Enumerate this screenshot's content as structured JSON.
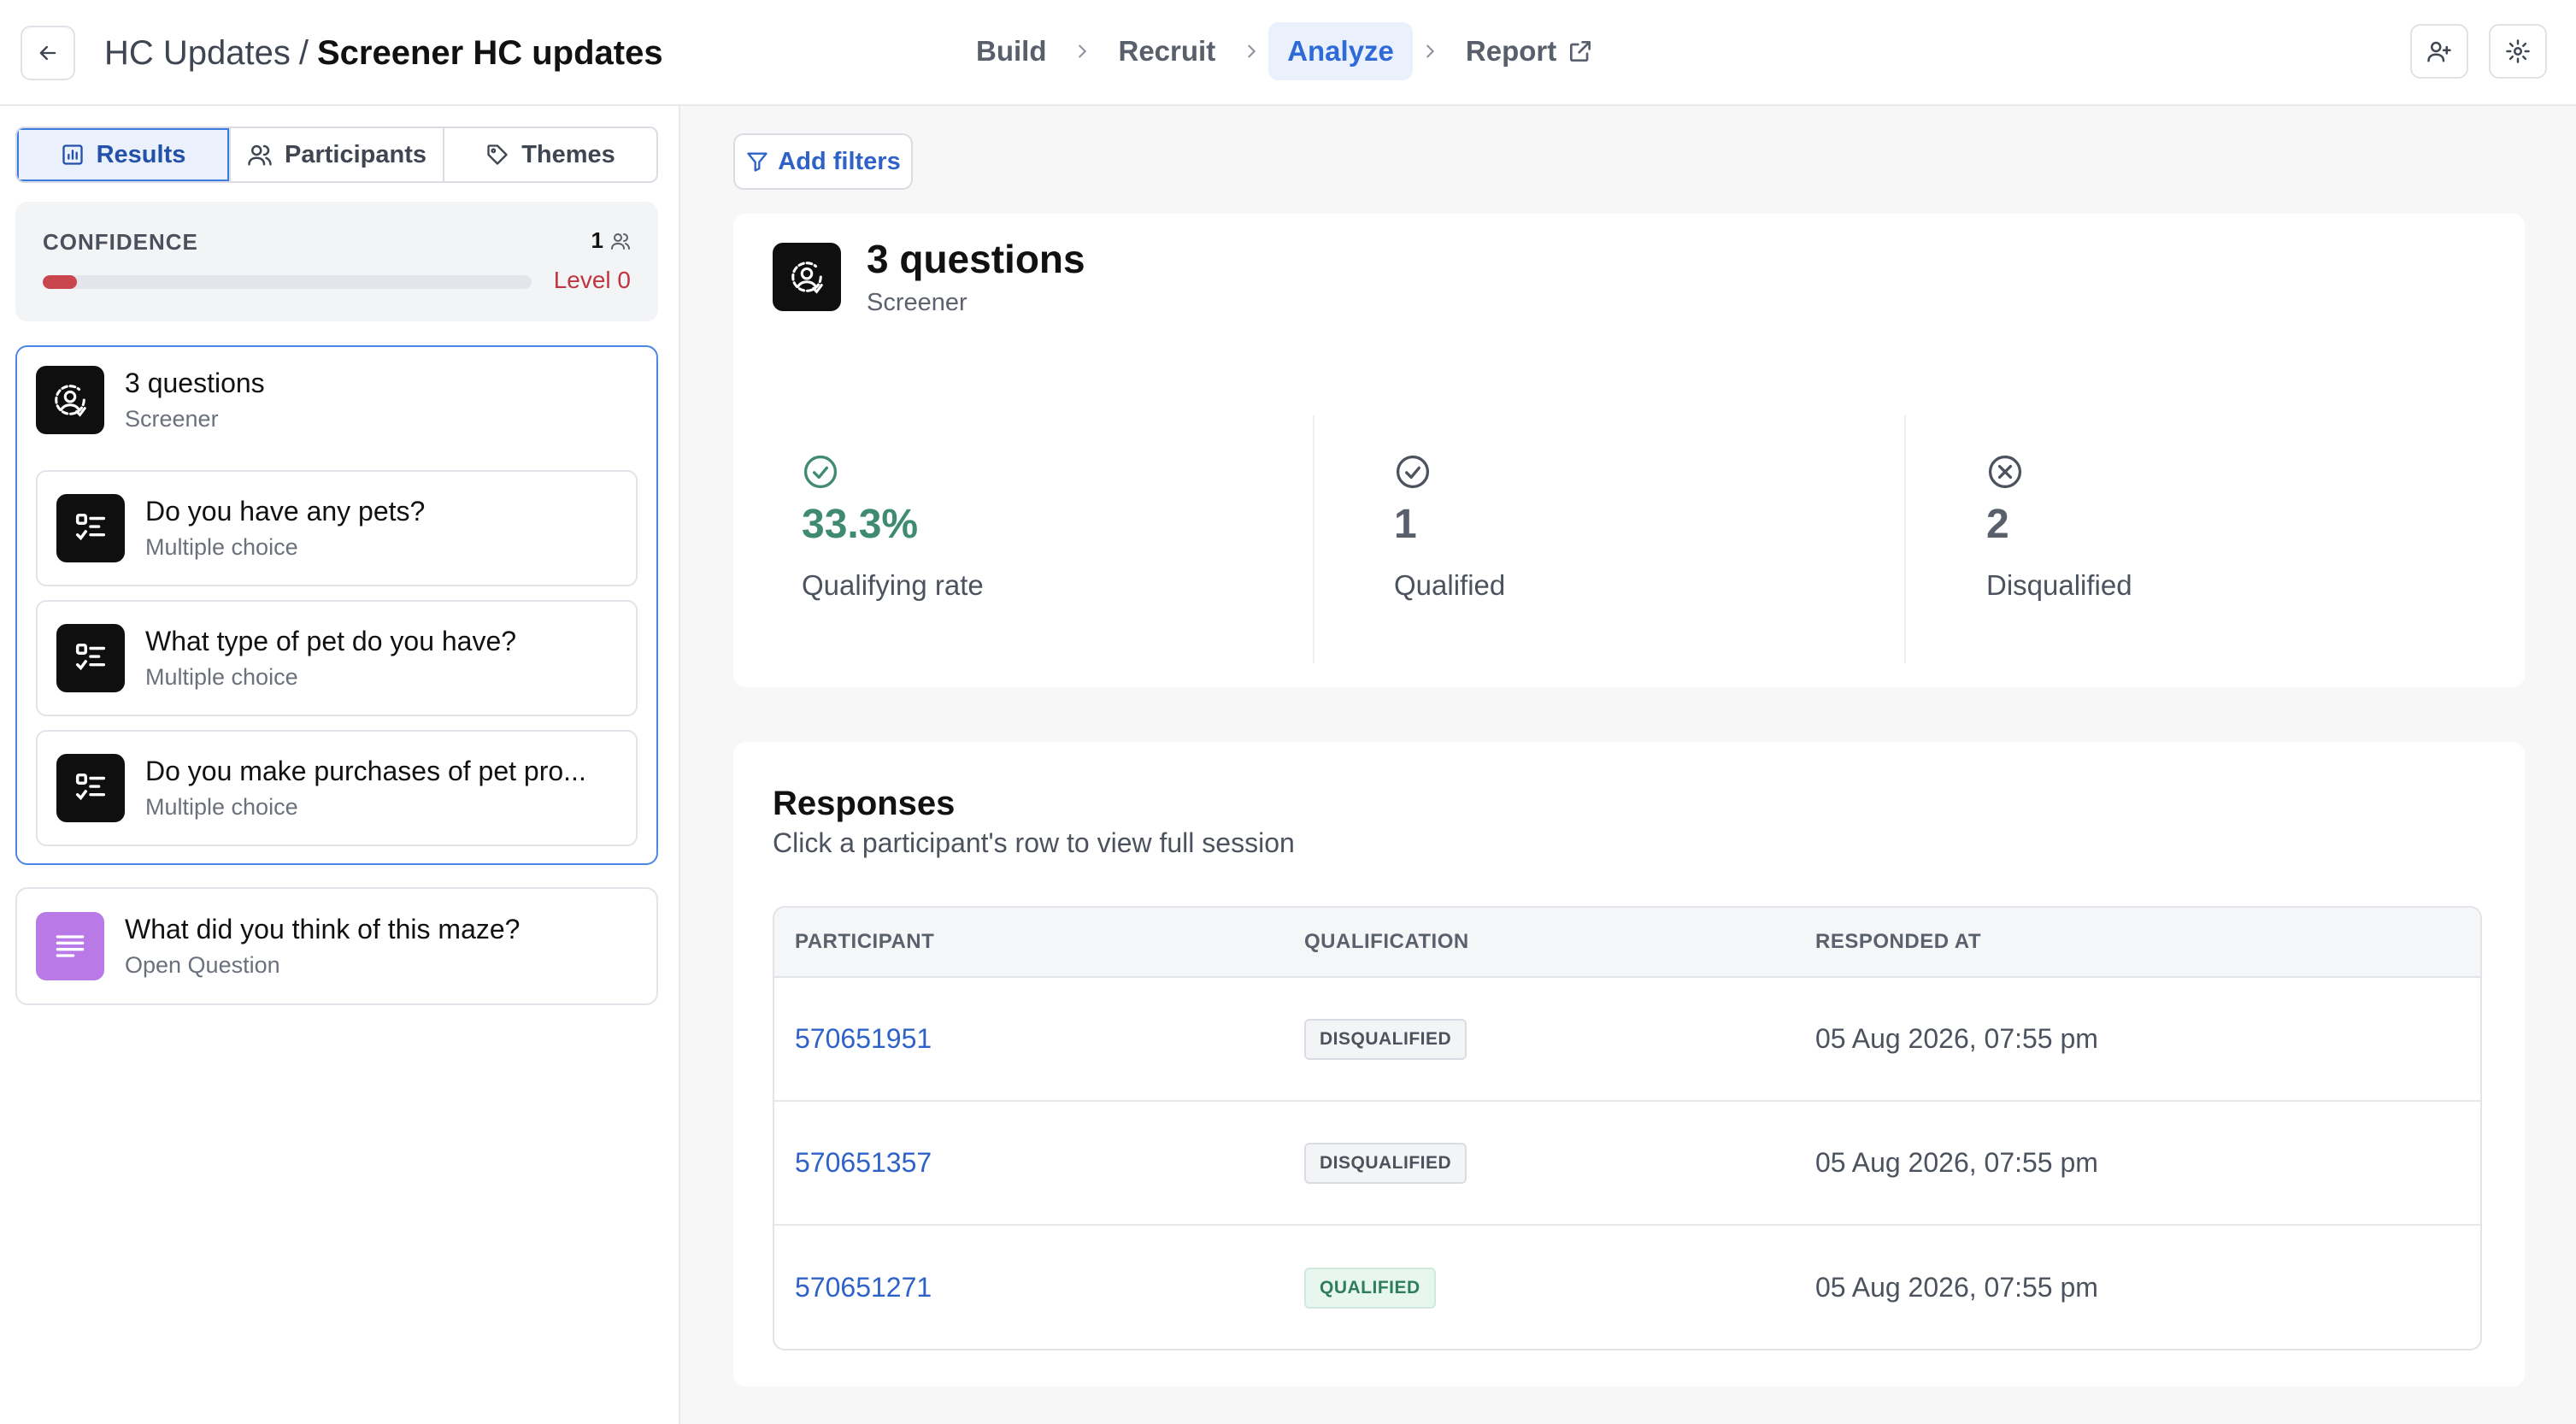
{
  "header": {
    "breadcrumb": "HC Updates",
    "separator": "/",
    "title": "Screener HC updates",
    "steps": [
      {
        "label": "Build",
        "active": false
      },
      {
        "label": "Recruit",
        "active": false
      },
      {
        "label": "Analyze",
        "active": true
      },
      {
        "label": "Report",
        "active": false
      }
    ]
  },
  "sidebar": {
    "tabs": [
      {
        "label": "Results",
        "icon": "bar-chart-icon",
        "active": true
      },
      {
        "label": "Participants",
        "icon": "users-icon",
        "active": false
      },
      {
        "label": "Themes",
        "icon": "tag-icon",
        "active": false
      }
    ],
    "confidence": {
      "label": "CONFIDENCE",
      "count": "1",
      "level": "Level 0",
      "progress": 0.07
    },
    "screener_block": {
      "title": "3 questions",
      "subtitle": "Screener",
      "questions": [
        {
          "title": "Do you have any pets?",
          "type": "Multiple choice"
        },
        {
          "title": "What type of pet do you have?",
          "type": "Multiple choice"
        },
        {
          "title": "Do you make purchases of pet pro...",
          "type": "Multiple choice"
        }
      ]
    },
    "maze_question": {
      "title": "What did you think of this maze?",
      "type": "Open Question"
    }
  },
  "main": {
    "filters_label": "Add filters",
    "summary": {
      "title": "3 questions",
      "subtitle": "Screener",
      "stats": [
        {
          "value": "33.3%",
          "label": "Qualifying rate"
        },
        {
          "value": "1",
          "label": "Qualified"
        },
        {
          "value": "2",
          "label": "Disqualified"
        }
      ]
    },
    "responses": {
      "title": "Responses",
      "subtitle": "Click a participant's row to view full session",
      "columns": [
        "PARTICIPANT",
        "QUALIFICATION",
        "RESPONDED AT"
      ],
      "rows": [
        {
          "participant": "570651951",
          "qualification": "DISQUALIFIED",
          "responded_at": "05 Aug 2026, 07:55 pm"
        },
        {
          "participant": "570651357",
          "qualification": "DISQUALIFIED",
          "responded_at": "05 Aug 2026, 07:55 pm"
        },
        {
          "participant": "570651271",
          "qualification": "QUALIFIED",
          "responded_at": "05 Aug 2026, 07:55 pm"
        }
      ]
    }
  },
  "colors": {
    "accent": "#2f6bd8",
    "qualified_green": "#3f8a72",
    "confidence_red": "#c9464e",
    "open_question_purple": "#b97ae8"
  }
}
